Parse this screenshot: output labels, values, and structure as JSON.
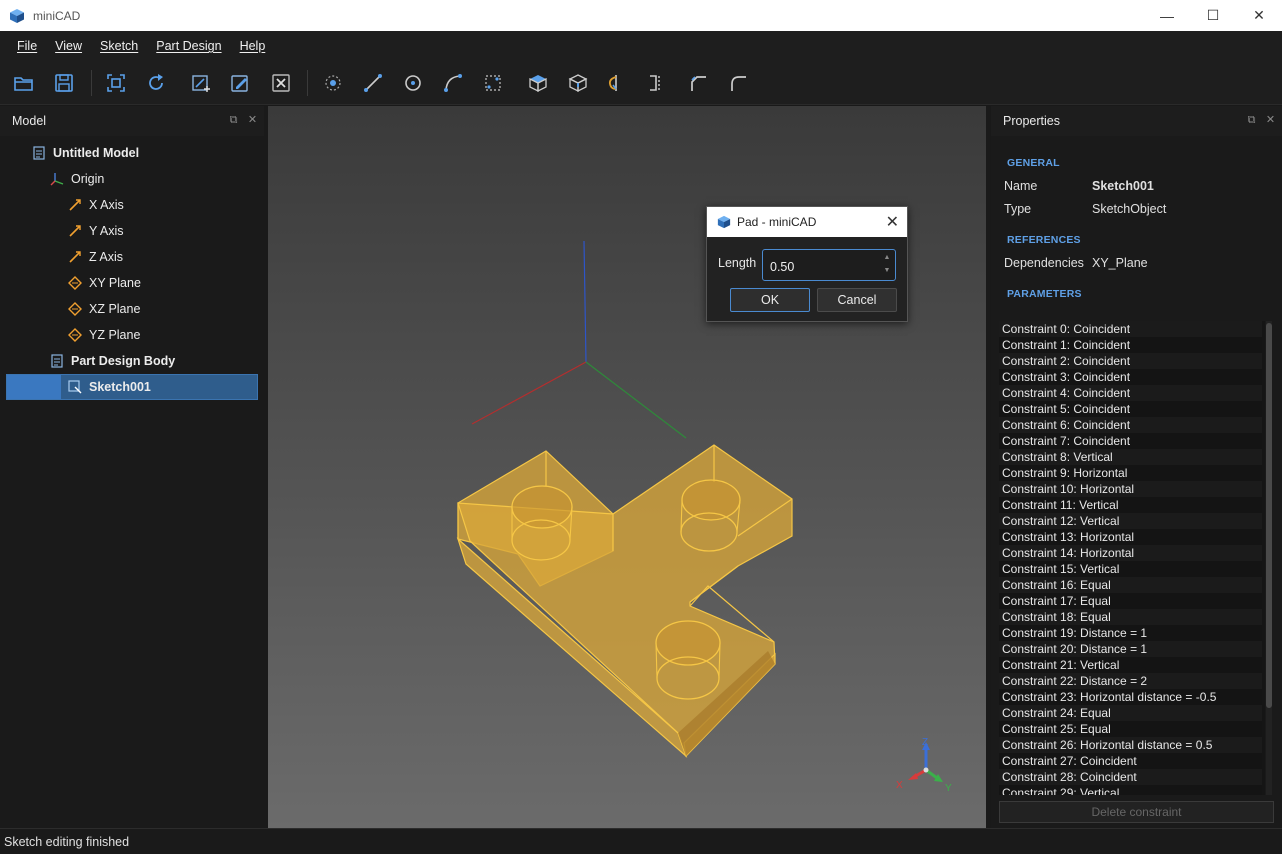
{
  "window": {
    "title": "miniCAD",
    "minimize": "—",
    "maximize": "☐",
    "close": "✕"
  },
  "menu": [
    "File",
    "View",
    "Sketch",
    "Part Design",
    "Help"
  ],
  "toolbar": {
    "icons": [
      "open-icon",
      "save-icon",
      "fit-view-icon",
      "refresh-icon",
      "new-sketch-icon",
      "edit-sketch-icon",
      "close-sketch-icon",
      "point-icon",
      "line-icon",
      "circle-icon",
      "arc-icon",
      "rectangle-icon",
      "pad-icon",
      "pocket-icon",
      "revolve-icon",
      "mirror-icon",
      "chamfer-icon",
      "fillet-icon"
    ]
  },
  "model_panel": {
    "title": "Model",
    "tree": [
      {
        "label": "Untitled Model",
        "icon": "document-icon",
        "bold": true
      },
      {
        "label": "Origin",
        "icon": "origin-axes-icon",
        "bold": false
      },
      {
        "label": "X Axis",
        "icon": "axis-icon",
        "bold": false
      },
      {
        "label": "Y Axis",
        "icon": "axis-icon",
        "bold": false
      },
      {
        "label": "Z Axis",
        "icon": "axis-icon",
        "bold": false
      },
      {
        "label": "XY Plane",
        "icon": "plane-icon",
        "bold": false
      },
      {
        "label": "XZ Plane",
        "icon": "plane-icon",
        "bold": false
      },
      {
        "label": "YZ Plane",
        "icon": "plane-icon",
        "bold": false
      },
      {
        "label": "Part Design Body",
        "icon": "document-icon",
        "bold": true
      },
      {
        "label": "Sketch001",
        "icon": "sketch-icon",
        "bold": true,
        "selected": true
      }
    ]
  },
  "properties": {
    "title": "Properties",
    "general_label": "GENERAL",
    "name_key": "Name",
    "name_val": "Sketch001",
    "type_key": "Type",
    "type_val": "SketchObject",
    "references_label": "REFERENCES",
    "deps_key": "Dependencies",
    "deps_val": "XY_Plane",
    "parameters_label": "PARAMETERS",
    "constraints": [
      "Constraint 0: Coincident",
      "Constraint 1: Coincident",
      "Constraint 2: Coincident",
      "Constraint 3: Coincident",
      "Constraint 4: Coincident",
      "Constraint 5: Coincident",
      "Constraint 6: Coincident",
      "Constraint 7: Coincident",
      "Constraint 8: Vertical",
      "Constraint 9: Horizontal",
      "Constraint 10: Horizontal",
      "Constraint 11: Vertical",
      "Constraint 12: Vertical",
      "Constraint 13: Horizontal",
      "Constraint 14: Horizontal",
      "Constraint 15: Vertical",
      "Constraint 16: Equal",
      "Constraint 17: Equal",
      "Constraint 18: Equal",
      "Constraint 19: Distance = 1",
      "Constraint 20: Distance = 1",
      "Constraint 21: Vertical",
      "Constraint 22: Distance = 2",
      "Constraint 23: Horizontal distance = -0.5",
      "Constraint 24: Equal",
      "Constraint 25: Equal",
      "Constraint 26: Horizontal distance = 0.5",
      "Constraint 27: Coincident",
      "Constraint 28: Coincident",
      "Constraint 29: Vertical"
    ],
    "delete_label": "Delete constraint"
  },
  "dialog": {
    "title": "Pad - miniCAD",
    "length_label": "Length",
    "length_value": "0.50",
    "ok_label": "OK",
    "cancel_label": "Cancel"
  },
  "axis_gizmo": {
    "x": "X",
    "y": "Y",
    "z": "Z"
  },
  "status": "Sketch editing finished",
  "colors": {
    "accent": "#3a78c0",
    "model_fill": "#d4a23a",
    "model_edge": "#f2c14a"
  }
}
